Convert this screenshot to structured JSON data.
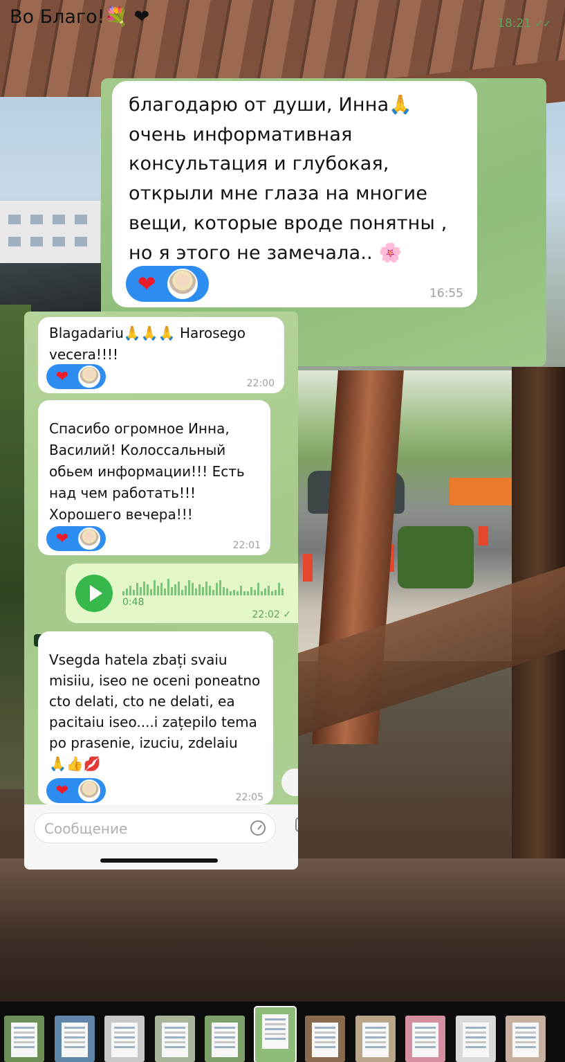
{
  "chat_top": {
    "incoming_message": {
      "text": "благодарю от души, Инна🙏\nочень информативная\nконсультация и глубокая,\nоткрыли мне глаза на многие\nвещи, которые вроде понятны ,\nно я этого не замечала.. 🌸",
      "reaction_emoji": "❤",
      "time": "16:55"
    },
    "outgoing_message": {
      "text": "Во Благо!💐 ❤",
      "time": "18:21",
      "status_icon": "double-check-icon"
    }
  },
  "chat_bottom": {
    "messages": [
      {
        "text": "Blagadariu🙏🙏🙏 Harosego\nvecera!!!!",
        "reaction_emoji": "❤",
        "time": "22:00"
      },
      {
        "text": "Спасибо огромное Инна,\nВасилий! Колоссальный\nобьем информации!!! Есть\nнад чем работать!!!\nХорошего вечера!!!",
        "reaction_emoji": "❤",
        "time": "22:01"
      },
      {
        "type": "voice",
        "duration": "0:48",
        "time": "22:02",
        "status_icon": "check-icon"
      },
      {
        "text": "Vsegda hatela zbați svaiu\nmisiiu, iseo ne oceni poneatno\ncto delati, cto ne delati, ea\npacitaiu iseo....i zațepilo tema\npo prasenie,   izuciu, zdelaiu\n🙏👍💋",
        "reaction_emoji": "❤",
        "time": "22:05"
      }
    ],
    "composer": {
      "placeholder": "Сообщение"
    }
  },
  "colors": {
    "reaction_pill": "#2e8df0",
    "outgoing_bubble": "#e3f7c9",
    "voice_play": "#36b84a"
  },
  "thumbnail_strip": {
    "count": 11,
    "active_index": 5
  }
}
